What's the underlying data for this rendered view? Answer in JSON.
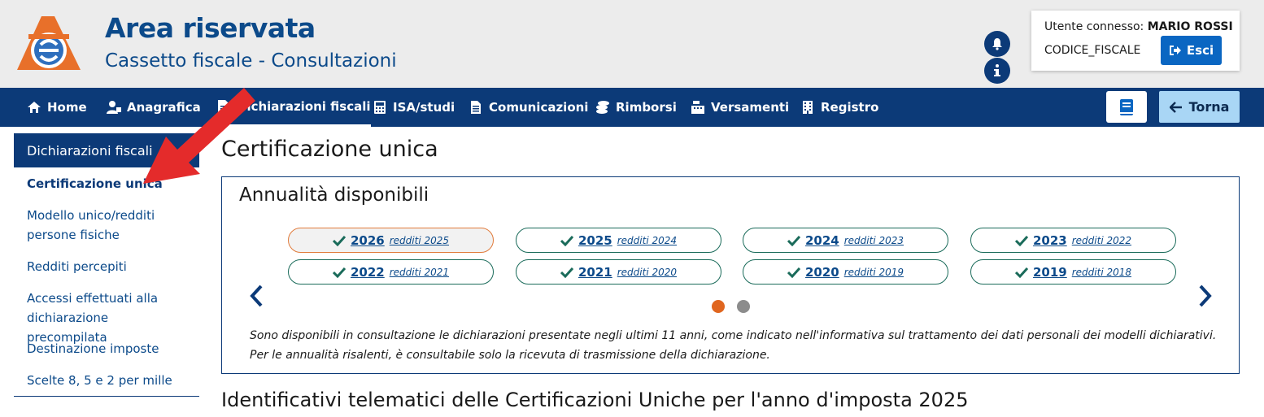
{
  "header": {
    "title": "Area riservata",
    "subtitle": "Cassetto fiscale - Consultazioni",
    "logo_icon": "agenzia-entrate-logo",
    "bell_icon": "bell-icon",
    "info_icon": "info-icon",
    "user_label": "Utente connesso:",
    "user_name": "MARIO ROSSI",
    "codice_fiscale": "CODICE_FISCALE",
    "logout_label": "Esci"
  },
  "nav": {
    "items": [
      {
        "label": "Home",
        "icon": "home-icon"
      },
      {
        "label": "Anagrafica",
        "icon": "user-icon"
      },
      {
        "label": "Dichiarazioni fiscali",
        "icon": "document-icon"
      },
      {
        "label": "ISA/studi",
        "icon": "calculator-icon"
      },
      {
        "label": "Comunicazioni",
        "icon": "file-icon"
      },
      {
        "label": "Rimborsi",
        "icon": "coins-icon"
      },
      {
        "label": "Versamenti",
        "icon": "cash-register-icon"
      },
      {
        "label": "Registro",
        "icon": "building-icon"
      }
    ],
    "active": "Dichiarazioni fiscali",
    "book_icon": "book-icon",
    "back_label": "Torna"
  },
  "sidebar": {
    "heading": "Dichiarazioni fiscali",
    "items": [
      {
        "label": "Certificazione unica",
        "active": true
      },
      {
        "label": "Modello unico/redditi persone fisiche"
      },
      {
        "label": "Redditi percepiti"
      },
      {
        "label": "Accessi effettuati alla dichiarazione precompilata"
      },
      {
        "label": "Destinazione imposte"
      },
      {
        "label": "Scelte 8, 5 e 2 per mille"
      }
    ]
  },
  "main": {
    "page_title": "Certificazione unica",
    "panel_title": "Annualità disponibili",
    "years": [
      {
        "year": "2026",
        "sub": "redditi 2025",
        "selected": true
      },
      {
        "year": "2025",
        "sub": "redditi 2024"
      },
      {
        "year": "2024",
        "sub": "redditi 2023"
      },
      {
        "year": "2023",
        "sub": "redditi 2022"
      },
      {
        "year": "2022",
        "sub": "redditi 2021"
      },
      {
        "year": "2021",
        "sub": "redditi 2020"
      },
      {
        "year": "2020",
        "sub": "redditi 2019"
      },
      {
        "year": "2019",
        "sub": "redditi 2018"
      }
    ],
    "carousel_pages": 2,
    "carousel_active_page": 1,
    "note": "Sono disponibili in consultazione le dichiarazioni presentate negli ultimi 11 anni, come indicato nell'informativa sul trattamento dei dati personali dei modelli dichiarativi. Per le annualità risalenti, è consultabile solo la ricevuta di trasmissione della dichiarazione.",
    "section_title": "Identificativi telematici delle Certificazioni Uniche per l'anno d'imposta 2025"
  },
  "colors": {
    "primary": "#0c3a78",
    "accent": "#e07a3a",
    "logout": "#0a66c2",
    "back_button": "#a9d6f5",
    "annotation_arrow": "#e02020"
  }
}
